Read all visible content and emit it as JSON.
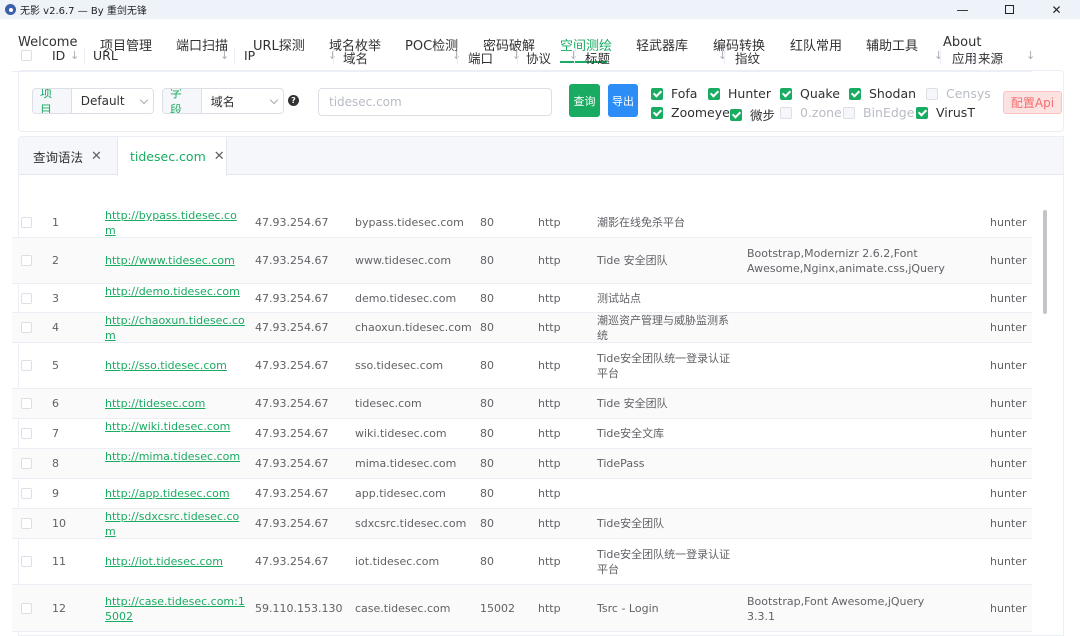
{
  "window": {
    "title": "无影 v2.6.7 — By 重剑无锋",
    "min": "—",
    "close": "✕"
  },
  "nav": [
    "Welcome",
    "项目管理",
    "端口扫描",
    "URL探测",
    "域名枚举",
    "POC检测",
    "密码破解",
    "空间测绘",
    "轻武器库",
    "编码转换",
    "红队常用",
    "辅助工具",
    "About"
  ],
  "nav_active": "空间测绘",
  "filter": {
    "project_label": "项目",
    "project_value": "Default",
    "field_label": "字段",
    "field_value": "域名",
    "help": "?",
    "search_placeholder": "tidesec.com",
    "query_button": "查询",
    "export_button": "导出",
    "api_button": "配置Api"
  },
  "engines": [
    {
      "name": "Fofa",
      "checked": true,
      "disabled": false
    },
    {
      "name": "Hunter",
      "checked": true,
      "disabled": false
    },
    {
      "name": "Quake",
      "checked": true,
      "disabled": false
    },
    {
      "name": "Shodan",
      "checked": true,
      "disabled": false
    },
    {
      "name": "Censys",
      "checked": false,
      "disabled": true
    },
    {
      "name": "Zoomeye",
      "checked": true,
      "disabled": false
    },
    {
      "name": "微步",
      "checked": true,
      "disabled": false
    },
    {
      "name": "0.zone",
      "checked": false,
      "disabled": true
    },
    {
      "name": "BinEdge",
      "checked": false,
      "disabled": true
    },
    {
      "name": "VirusT",
      "checked": true,
      "disabled": false
    }
  ],
  "tabs": {
    "syntax": "查询语法",
    "result": "tidesec.com",
    "close": "✕"
  },
  "columns": [
    "ID",
    "URL",
    "IP",
    "域名",
    "端口",
    "协议",
    "标题",
    "指纹",
    "应用",
    "来源"
  ],
  "sort_icon": "↓",
  "rows": [
    {
      "id": "1",
      "url": "http://bypass.tidesec.com",
      "ip": "47.93.254.67",
      "domain": "bypass.tidesec.com",
      "port": "80",
      "proto": "http",
      "title": "潮影在线免杀平台",
      "finger": "",
      "source": "hunter"
    },
    {
      "id": "2",
      "url": "http://www.tidesec.com",
      "ip": "47.93.254.67",
      "domain": "www.tidesec.com",
      "port": "80",
      "proto": "http",
      "title": "Tide 安全团队",
      "finger": "Bootstrap,Modernizr 2.6.2,Font Awesome,Nginx,animate.css,jQuery",
      "source": "hunter"
    },
    {
      "id": "3",
      "url": "http://demo.tidesec.com",
      "ip": "47.93.254.67",
      "domain": "demo.tidesec.com",
      "port": "80",
      "proto": "http",
      "title": "测试站点",
      "finger": "",
      "source": "hunter"
    },
    {
      "id": "4",
      "url": "http://chaoxun.tidesec.com",
      "ip": "47.93.254.67",
      "domain": "chaoxun.tidesec.com",
      "port": "80",
      "proto": "http",
      "title": "潮巡资产管理与威胁监测系统",
      "finger": "",
      "source": "hunter"
    },
    {
      "id": "5",
      "url": "http://sso.tidesec.com",
      "ip": "47.93.254.67",
      "domain": "sso.tidesec.com",
      "port": "80",
      "proto": "http",
      "title": "Tide安全团队统一登录认证平台",
      "finger": "",
      "source": "hunter"
    },
    {
      "id": "6",
      "url": "http://tidesec.com",
      "ip": "47.93.254.67",
      "domain": "tidesec.com",
      "port": "80",
      "proto": "http",
      "title": "Tide 安全团队",
      "finger": "",
      "source": "hunter"
    },
    {
      "id": "7",
      "url": "http://wiki.tidesec.com",
      "ip": "47.93.254.67",
      "domain": "wiki.tidesec.com",
      "port": "80",
      "proto": "http",
      "title": "Tide安全文库",
      "finger": "",
      "source": "hunter"
    },
    {
      "id": "8",
      "url": "http://mima.tidesec.com",
      "ip": "47.93.254.67",
      "domain": "mima.tidesec.com",
      "port": "80",
      "proto": "http",
      "title": "TidePass",
      "finger": "",
      "source": "hunter"
    },
    {
      "id": "9",
      "url": "http://app.tidesec.com",
      "ip": "47.93.254.67",
      "domain": "app.tidesec.com",
      "port": "80",
      "proto": "http",
      "title": "",
      "finger": "",
      "source": "hunter"
    },
    {
      "id": "10",
      "url": "http://sdxcsrc.tidesec.com",
      "ip": "47.93.254.67",
      "domain": "sdxcsrc.tidesec.com",
      "port": "80",
      "proto": "http",
      "title": "Tide安全团队",
      "finger": "",
      "source": "hunter"
    },
    {
      "id": "11",
      "url": "http://iot.tidesec.com",
      "ip": "47.93.254.67",
      "domain": "iot.tidesec.com",
      "port": "80",
      "proto": "http",
      "title": "Tide安全团队统一登录认证平台",
      "finger": "",
      "source": "hunter"
    },
    {
      "id": "12",
      "url": "http://case.tidesec.com:15002",
      "ip": "59.110.153.130",
      "domain": "case.tidesec.com",
      "port": "15002",
      "proto": "http",
      "title": "Tsrc - Login",
      "finger": "Bootstrap,Font Awesome,jQuery 3.3.1",
      "source": "hunter"
    }
  ],
  "colors": {
    "accent": "#1aab62",
    "export": "#2b8df5",
    "api_bg": "#fde2e2",
    "api_text": "#f56c6c"
  }
}
